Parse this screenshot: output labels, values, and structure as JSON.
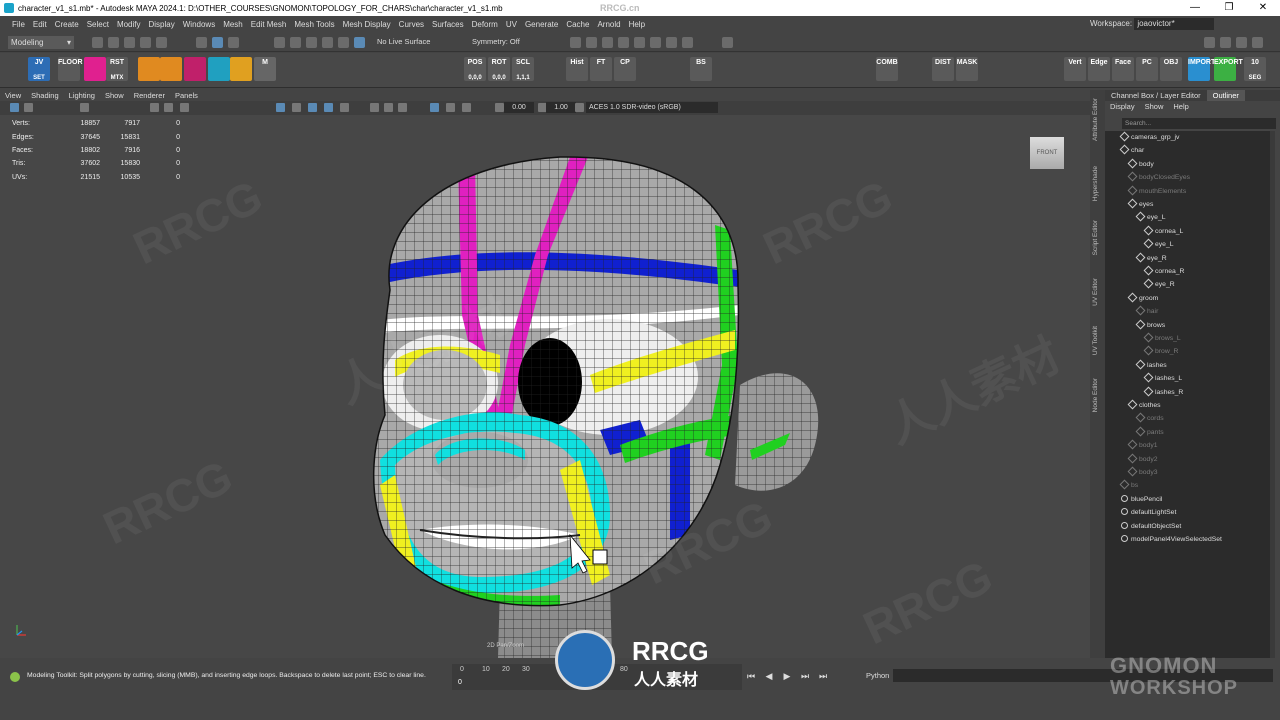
{
  "window": {
    "title": "character_v1_s1.mb* - Autodesk MAYA 2024.1: D:\\OTHER_COURSES\\GNOMON\\TOPOLOGY_FOR_CHARS\\char\\character_v1_s1.mb",
    "controls": [
      "—",
      "❐",
      "✕"
    ],
    "site_watermark": "RRCG.cn"
  },
  "menubar": {
    "items": [
      "File",
      "Edit",
      "Create",
      "Select",
      "Modify",
      "Display",
      "Windows",
      "Mesh",
      "Edit Mesh",
      "Mesh Tools",
      "Mesh Display",
      "Curves",
      "Surfaces",
      "Deform",
      "UV",
      "Generate",
      "Cache",
      "Arnold",
      "Help"
    ],
    "workspace_label": "Workspace:",
    "workspace_value": "joaovictor*"
  },
  "statusline": {
    "mode": "Modeling",
    "live_surface": "No Live Surface",
    "symmetry": "Symmetry: Off"
  },
  "shelf": [
    {
      "label": "JV",
      "sub": "SET",
      "color": "#2d6db5"
    },
    {
      "label": "FLOOR",
      "sub": "",
      "color": "#5a5a5a"
    },
    {
      "label": "",
      "sub": "",
      "color": "#e0208f"
    },
    {
      "label": "RST",
      "sub": "MTX",
      "color": "#5a5a5a"
    },
    {
      "label": "",
      "sub": "",
      "color": "#e08a20"
    },
    {
      "label": "",
      "sub": "",
      "color": "#e08a20"
    },
    {
      "label": "",
      "sub": "",
      "color": "#c0206a"
    },
    {
      "label": "",
      "sub": "",
      "color": "#20a0c0"
    },
    {
      "label": "",
      "sub": "",
      "color": "#e0a020"
    },
    {
      "label": "M",
      "sub": "",
      "color": "#666"
    },
    {
      "label": "POS",
      "sub": "0,0,0",
      "color": "#5a5a5a"
    },
    {
      "label": "ROT",
      "sub": "0,0,0",
      "color": "#5a5a5a"
    },
    {
      "label": "SCL",
      "sub": "1,1,1",
      "color": "#5a5a5a"
    },
    {
      "label": "Hist",
      "sub": "",
      "color": "#5a5a5a"
    },
    {
      "label": "FT",
      "sub": "",
      "color": "#5a5a5a"
    },
    {
      "label": "CP",
      "sub": "",
      "color": "#5a5a5a"
    },
    {
      "label": "BS",
      "sub": "",
      "color": "#5a5a5a"
    },
    {
      "label": "COMB",
      "sub": "",
      "color": "#5a5a5a"
    },
    {
      "label": "DIST",
      "sub": "",
      "color": "#5a5a5a"
    },
    {
      "label": "MASK",
      "sub": "",
      "color": "#5a5a5a"
    },
    {
      "label": "Vert",
      "sub": "",
      "color": "#5a5a5a"
    },
    {
      "label": "Edge",
      "sub": "",
      "color": "#5a5a5a"
    },
    {
      "label": "Face",
      "sub": "",
      "color": "#5a5a5a"
    },
    {
      "label": "PC",
      "sub": "",
      "color": "#5a5a5a"
    },
    {
      "label": "OBJ",
      "sub": "",
      "color": "#5a5a5a"
    },
    {
      "label": "IMPORT",
      "sub": "",
      "color": "#2a8fd0"
    },
    {
      "label": "EXPORT",
      "sub": "",
      "color": "#3cb043"
    },
    {
      "label": "10",
      "sub": "SEG",
      "color": "#5a5a5a"
    }
  ],
  "panel": {
    "menus": [
      "View",
      "Shading",
      "Lighting",
      "Show",
      "Renderer",
      "Panels"
    ],
    "field_a": "0.00",
    "field_b": "1.00",
    "colorspace": "ACES 1.0 SDR-video (sRGB)"
  },
  "hud": [
    {
      "label": "Verts:",
      "a": "18857",
      "b": "7917",
      "c": "0"
    },
    {
      "label": "Edges:",
      "a": "37645",
      "b": "15831",
      "c": "0"
    },
    {
      "label": "Faces:",
      "a": "18802",
      "b": "7916",
      "c": "0"
    },
    {
      "label": "Tris:",
      "a": "37602",
      "b": "15830",
      "c": "0"
    },
    {
      "label": "UVs:",
      "a": "21515",
      "b": "10535",
      "c": "0"
    }
  ],
  "viewcube": "FRONT",
  "panzoom": "2D Pan/Zoom",
  "watermarks": [
    "RRCG",
    "人人素材"
  ],
  "sidetabs": [
    "Attribute Editor",
    "Hypershade",
    "Script Editor",
    "UV Editor",
    "UV Toolkit",
    "Node Editor"
  ],
  "outliner": {
    "tabs": [
      "Channel Box / Layer Editor",
      "Outliner"
    ],
    "menus": [
      "Display",
      "Show",
      "Help"
    ],
    "search_placeholder": "Search...",
    "items": [
      {
        "name": "cameras_grp_jv",
        "level": 1,
        "dim": false
      },
      {
        "name": "char",
        "level": 1,
        "dim": false
      },
      {
        "name": "body",
        "level": 2,
        "dim": false
      },
      {
        "name": "bodyClosedEyes",
        "level": 2,
        "dim": true
      },
      {
        "name": "mouthElements",
        "level": 2,
        "dim": true
      },
      {
        "name": "eyes",
        "level": 2,
        "dim": false
      },
      {
        "name": "eye_L",
        "level": 3,
        "dim": false
      },
      {
        "name": "cornea_L",
        "level": 4,
        "dim": false
      },
      {
        "name": "eye_L",
        "level": 4,
        "dim": false
      },
      {
        "name": "eye_R",
        "level": 3,
        "dim": false
      },
      {
        "name": "cornea_R",
        "level": 4,
        "dim": false
      },
      {
        "name": "eye_R",
        "level": 4,
        "dim": false
      },
      {
        "name": "groom",
        "level": 2,
        "dim": false
      },
      {
        "name": "hair",
        "level": 3,
        "dim": true
      },
      {
        "name": "brows",
        "level": 3,
        "dim": false
      },
      {
        "name": "brows_L",
        "level": 4,
        "dim": true
      },
      {
        "name": "brow_R",
        "level": 4,
        "dim": true
      },
      {
        "name": "lashes",
        "level": 3,
        "dim": false
      },
      {
        "name": "lashes_L",
        "level": 4,
        "dim": false
      },
      {
        "name": "lashes_R",
        "level": 4,
        "dim": false
      },
      {
        "name": "clothes",
        "level": 2,
        "dim": false
      },
      {
        "name": "cords",
        "level": 3,
        "dim": true
      },
      {
        "name": "pants",
        "level": 3,
        "dim": true
      },
      {
        "name": "body1",
        "level": 2,
        "dim": true
      },
      {
        "name": "body2",
        "level": 2,
        "dim": true
      },
      {
        "name": "body3",
        "level": 2,
        "dim": true
      },
      {
        "name": "bs",
        "level": 1,
        "dim": true
      },
      {
        "name": "bluePencil",
        "level": 1,
        "dim": false
      },
      {
        "name": "defaultLightSet",
        "level": 1,
        "dim": false
      },
      {
        "name": "defaultObjectSet",
        "level": 1,
        "dim": false
      },
      {
        "name": "modelPanel4ViewSelectedSet",
        "level": 1,
        "dim": false
      }
    ]
  },
  "helpline": "Modeling Toolkit: Split polygons by cutting, slicing (MMB), and inserting edge loops. Backspace to delete last point; ESC to clear line.",
  "timeslider": {
    "ticks": [
      "0",
      "10",
      "20",
      "30",
      "80"
    ],
    "current": "0"
  },
  "playback": [
    "⏮",
    "◀",
    "▶",
    "⏭",
    "⏭"
  ],
  "python_label": "Python",
  "logos": {
    "rrcg": "RRCG",
    "rrcg_sub": "人人素材",
    "gnomon_1": "GNOMON",
    "gnomon_2": "WORKSHOP"
  },
  "colors": {
    "magenta": "#e020c0",
    "blue": "#1020d0",
    "yellow": "#f0f020",
    "cyan": "#10e0e0",
    "green": "#20d020",
    "white": "#ffffff"
  }
}
